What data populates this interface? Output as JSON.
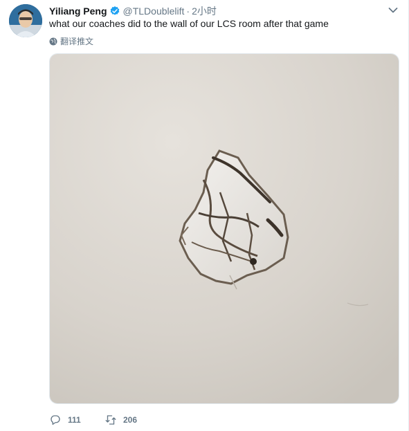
{
  "tweet": {
    "author_name": "Yiliang Peng",
    "handle": "@TLDoublelift",
    "separator": "·",
    "time": "2小时",
    "text": "what our coaches did to the wall of our LCS room after that game",
    "translate_label": "翻译推文",
    "verified": true
  },
  "actions": {
    "reply_count": "111",
    "retweet_count": "206"
  },
  "colors": {
    "accent": "#1da1f2",
    "muted": "#657786",
    "text": "#14171a",
    "wall": "#d8d3cc"
  },
  "icons": {
    "verified": "verified-badge-icon",
    "more": "chevron-down-icon",
    "translate": "globe-icon",
    "reply": "reply-icon",
    "retweet": "retweet-icon"
  }
}
